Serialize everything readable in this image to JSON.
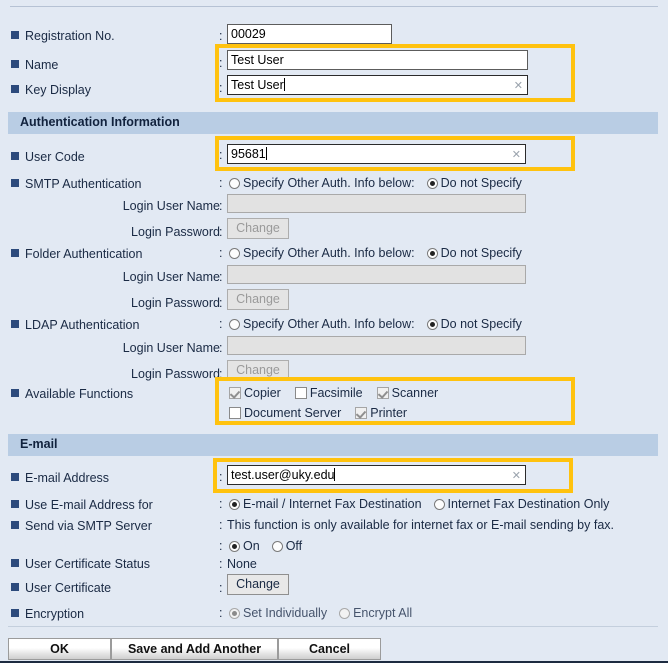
{
  "colors": {
    "background": "#e2e9f3",
    "section_header": "#b9cde4",
    "highlight": "#ffc20e",
    "bullet": "#2c4a7c",
    "text": "#1a2a44"
  },
  "fields": {
    "registration_no": {
      "label": "Registration No.",
      "value": "00029"
    },
    "name": {
      "label": "Name",
      "value": "Test User"
    },
    "key_display": {
      "label": "Key Display",
      "value": "Test User",
      "clear_icon": "clear-x-icon"
    }
  },
  "sections": {
    "auth": {
      "title": "Authentication Information"
    },
    "email": {
      "title": "E-mail"
    }
  },
  "auth": {
    "user_code": {
      "label": "User Code",
      "value": "95681",
      "clear_icon": "clear-x-icon"
    },
    "smtp": {
      "label": "SMTP Authentication",
      "option_specify": "Specify Other Auth. Info below:",
      "option_do_not": "Do not Specify",
      "selected": "do_not_specify",
      "login_user_name_label": "Login User Name",
      "login_user_name_value": "",
      "login_password_label": "Login Password",
      "change_label": "Change"
    },
    "folder": {
      "label": "Folder Authentication",
      "option_specify": "Specify Other Auth. Info below:",
      "option_do_not": "Do not Specify",
      "selected": "do_not_specify",
      "login_user_name_label": "Login User Name",
      "login_user_name_value": "",
      "login_password_label": "Login Password",
      "change_label": "Change"
    },
    "ldap": {
      "label": "LDAP Authentication",
      "option_specify": "Specify Other Auth. Info below:",
      "option_do_not": "Do not Specify",
      "selected": "do_not_specify",
      "login_user_name_label": "Login User Name",
      "login_user_name_value": "",
      "login_password_label": "Login Password",
      "change_label": "Change"
    },
    "available_functions": {
      "label": "Available Functions",
      "items": [
        {
          "label": "Copier",
          "checked": true
        },
        {
          "label": "Facsimile",
          "checked": false
        },
        {
          "label": "Scanner",
          "checked": true
        },
        {
          "label": "Document Server",
          "checked": false
        },
        {
          "label": "Printer",
          "checked": true
        }
      ]
    }
  },
  "email": {
    "address": {
      "label": "E-mail Address",
      "value": "test.user@uky.edu",
      "clear_icon": "clear-x-icon"
    },
    "use_for": {
      "label": "Use E-mail Address for",
      "option_a": "E-mail / Internet Fax Destination",
      "option_b": "Internet Fax Destination Only",
      "selected": "option_a"
    },
    "send_via_smtp": {
      "label": "Send via SMTP Server",
      "note": "This function is only available for internet fax or E-mail sending by fax.",
      "option_on": "On",
      "option_off": "Off",
      "selected": "on"
    },
    "cert_status": {
      "label": "User Certificate Status",
      "value": "None"
    },
    "user_certificate": {
      "label": "User Certificate",
      "change_label": "Change"
    },
    "encryption": {
      "label": "Encryption",
      "option_set_individually": "Set Individually",
      "option_encrypt_all": "Encrypt All",
      "selected": "set_individually"
    }
  },
  "buttons": {
    "ok": "OK",
    "save_and_add_another": "Save and Add Another",
    "cancel": "Cancel"
  }
}
